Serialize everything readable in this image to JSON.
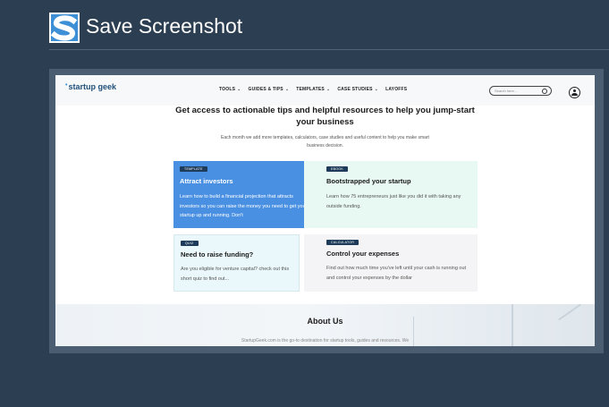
{
  "app": {
    "title": "Save Screenshot",
    "logo_icon": "s-logo-icon",
    "colors": {
      "background": "#2c3e52",
      "logo": "#3d8fd6"
    }
  },
  "site": {
    "brand": "startup geek",
    "nav": [
      {
        "label": "TOOLS",
        "has_dropdown": true
      },
      {
        "label": "GUIDES & TIPS",
        "has_dropdown": true
      },
      {
        "label": "TEMPLATES",
        "has_dropdown": true
      },
      {
        "label": "CASE STUDIES",
        "has_dropdown": true
      },
      {
        "label": "LAYOFFS",
        "has_dropdown": false
      }
    ],
    "search": {
      "placeholder": "Search here...",
      "icon": "search-icon"
    },
    "account_icon": "user-icon",
    "hero": {
      "title": "Get access to actionable tips and helpful resources to help you jump-start your business",
      "subtitle": "Each month we add more templates, calculators, case studies and useful content to help you make smart business decision."
    },
    "cards": [
      {
        "badge": "TEMPLATE",
        "title": "Attract investors",
        "description": "Learn how to build a financial projection that attracts investors so you can raise the money you need to get your startup up and running. Don't"
      },
      {
        "badge": "EBOOK",
        "title": "Bootstrapped your startup",
        "description": "Learn how 75 entrepreneurs just like you did it with taking any outside funding."
      },
      {
        "badge": "QUIZ",
        "title": "Need to raise funding?",
        "description": "Are you eligible for venture capital? check out this short quiz to find out..."
      },
      {
        "badge": "CALCULATOR",
        "title": "Control your expenses",
        "description": "Find out how much time you've left until your cash is running out and control your expenses by the dollar"
      }
    ],
    "about": {
      "title": "About Us",
      "text": "StartupGeek.com is the go-to destination for startup tools, guides and resources. We"
    }
  }
}
